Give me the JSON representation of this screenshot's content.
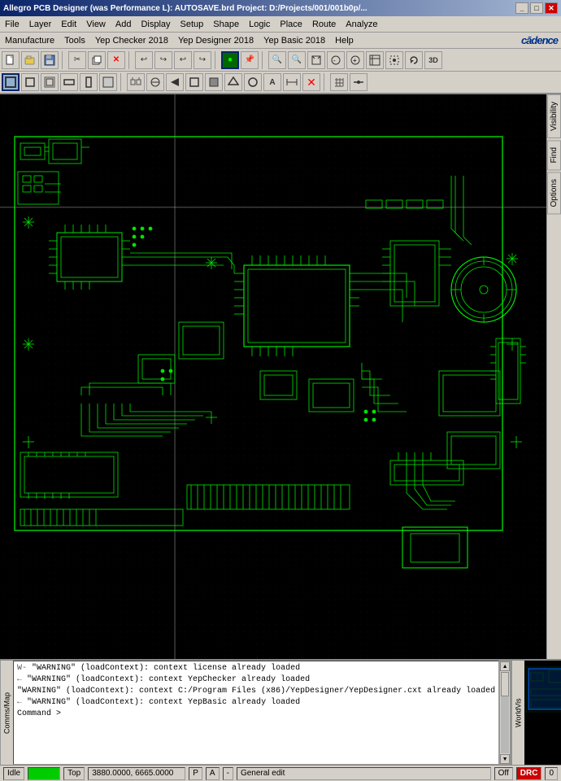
{
  "titlebar": {
    "title": "Allegro PCB Designer (was Performance L): AUTOSAVE.brd  Project: D:/Projects/001/001b0p/...",
    "controls": [
      "_",
      "□",
      "✕"
    ]
  },
  "menubar1": {
    "items": [
      "File",
      "Layer",
      "Edit",
      "View",
      "Add",
      "Display",
      "Setup",
      "Shape",
      "Logic",
      "Place",
      "Route",
      "Analyze"
    ]
  },
  "menubar2": {
    "items": [
      "Manufacture",
      "Tools",
      "Yep Checker 2018",
      "Yep Designer 2018",
      "Yep Basic 2018",
      "Help"
    ],
    "logo": "cādence"
  },
  "toolbar1": {
    "buttons": [
      "📂",
      "📁",
      "💾",
      "✂",
      "📋",
      "❌",
      "↩",
      "↪",
      "↩",
      "↪",
      "⚡",
      "📌",
      "🔍",
      "🔍",
      "🔍",
      "🔍",
      "🔍",
      "🔍",
      "🔍",
      "🔍",
      "🔍",
      "🔍"
    ]
  },
  "toolbar2": {
    "buttons": [
      "□",
      "□",
      "□",
      "□",
      "□",
      "□",
      "□",
      "□",
      "□",
      "○",
      "➤",
      "□",
      "□",
      "□",
      "□",
      "□",
      "□",
      "□",
      "□",
      "⊕",
      "✕",
      "□",
      "□"
    ]
  },
  "right_panel": {
    "tabs": [
      "Visibility",
      "Find",
      "Options"
    ]
  },
  "log": {
    "lines": [
      {
        "prefix": "W-",
        "text": "\"WARNING\" (loadContext): context license already loaded"
      },
      {
        "prefix": "←",
        "text": "\"WARNING\" (loadContext): context YepChecker already loaded"
      },
      {
        "prefix": "",
        "text": "\"WARNING\" (loadContext): context C:/Program Files (x86)/YepDesigner/YepDesigner.cxt already loaded"
      },
      {
        "prefix": "←",
        "text": "\"WARNING\" (loadContext): context YepBasic already loaded"
      },
      {
        "prefix": "",
        "text": "Command >"
      }
    ]
  },
  "statusbar": {
    "idle": "Idle",
    "indicator": "●●●",
    "layer": "Top",
    "coordinates": "3880.0000, 6665.0000",
    "mode1": "P",
    "mode2": "A",
    "separator": "-",
    "edit_mode": "General edit",
    "off_label": "Off",
    "drc_label": "DRC",
    "number": "0"
  },
  "worldview": {
    "label": "WorldVis"
  }
}
